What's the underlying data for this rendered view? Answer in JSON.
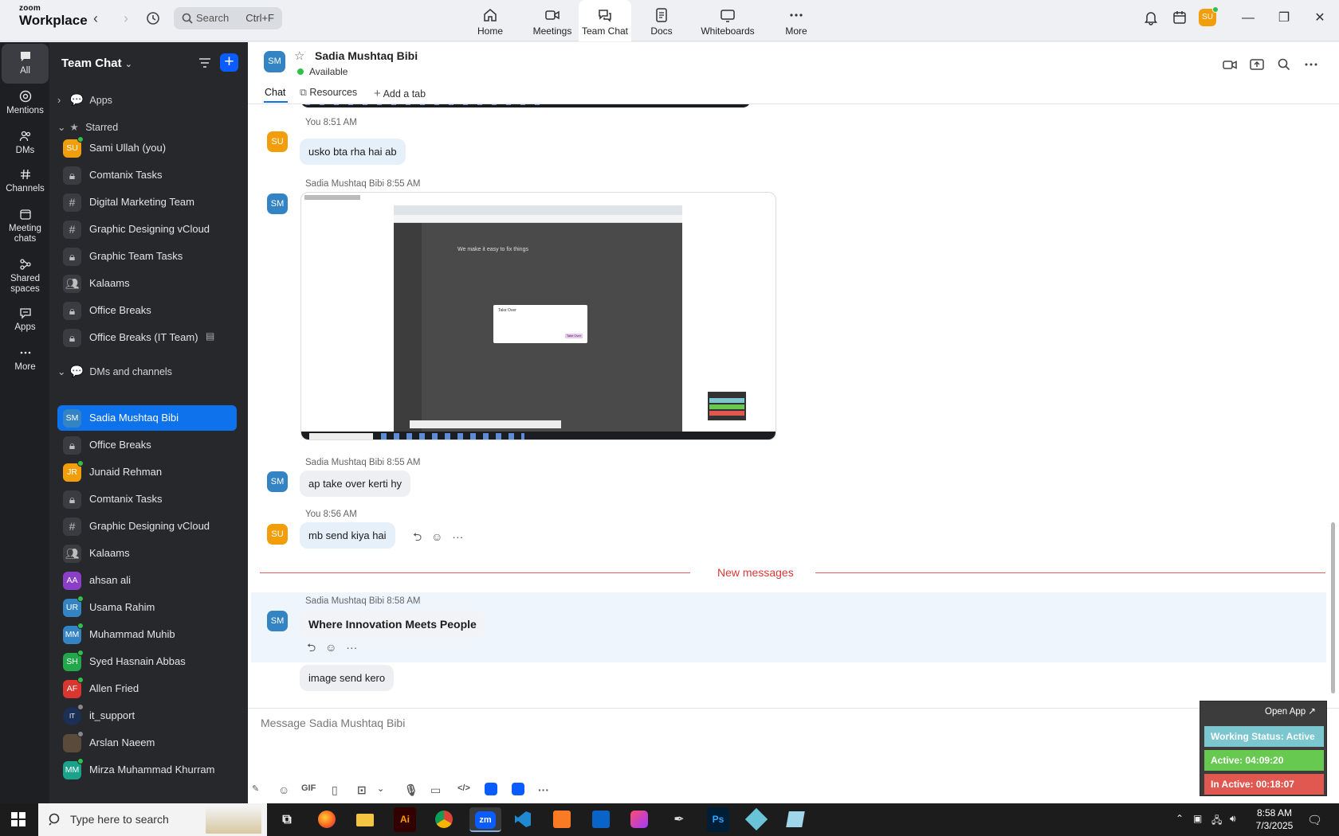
{
  "titlebar": {
    "logo_line1": "zoom",
    "logo_line2": "Workplace",
    "search_placeholder": "Search",
    "search_shortcut": "Ctrl+F",
    "tabs": [
      {
        "label": "Home",
        "icon": "home-icon"
      },
      {
        "label": "Meetings",
        "icon": "video-icon"
      },
      {
        "label": "Team Chat",
        "icon": "chat-icon"
      },
      {
        "label": "Docs",
        "icon": "doc-icon"
      },
      {
        "label": "Whiteboards",
        "icon": "whiteboard-icon"
      },
      {
        "label": "More",
        "icon": "more-icon"
      }
    ],
    "user_initials": "SU"
  },
  "rail": [
    {
      "label": "All"
    },
    {
      "label": "Mentions"
    },
    {
      "label": "DMs"
    },
    {
      "label": "Channels"
    },
    {
      "label": "Meeting chats"
    },
    {
      "label": "Shared spaces"
    },
    {
      "label": "Apps"
    },
    {
      "label": "More"
    }
  ],
  "sidebar": {
    "title": "Team Chat",
    "sections": {
      "apps": "Apps",
      "starred": "Starred",
      "dms": "DMs and channels"
    },
    "starred": [
      {
        "label": "Sami Ullah (you)",
        "initials": "SU",
        "color": "#f29e0b"
      },
      {
        "label": "Comtanix Tasks"
      },
      {
        "label": "Digital Marketing Team"
      },
      {
        "label": "Graphic Designing vCloud"
      },
      {
        "label": "Graphic Team Tasks"
      },
      {
        "label": "Kalaams"
      },
      {
        "label": "Office Breaks"
      },
      {
        "label": "Office Breaks (IT Team)"
      }
    ],
    "dms": [
      {
        "label": "Sadia Mushtaq Bibi",
        "initials": "SM",
        "color": "#3484c4"
      },
      {
        "label": "Office Breaks"
      },
      {
        "label": "Junaid Rehman",
        "initials": "JR",
        "color": "#f29e0b"
      },
      {
        "label": "Comtanix Tasks"
      },
      {
        "label": "Graphic Designing vCloud"
      },
      {
        "label": "Kalaams"
      },
      {
        "label": "ahsan ali",
        "initials": "AA",
        "color": "#8b3fc9"
      },
      {
        "label": "Usama Rahim",
        "initials": "UR",
        "color": "#3484c4"
      },
      {
        "label": "Muhammad Muhib",
        "initials": "MM",
        "color": "#3484c4"
      },
      {
        "label": "Syed Hasnain Abbas",
        "initials": "SH",
        "color": "#22a84a"
      },
      {
        "label": "Allen Fried",
        "initials": "AF",
        "color": "#d8362f"
      },
      {
        "label": "it_support",
        "initials": "IT"
      },
      {
        "label": "Arslan Naeem"
      },
      {
        "label": "Mirza Muhammad Khurram",
        "initials": "MM",
        "color": "#1aa38a"
      }
    ]
  },
  "chat": {
    "contact_initials": "SM",
    "contact_name": "Sadia Mushtaq Bibi",
    "status": "Available",
    "tabs": {
      "chat": "Chat",
      "resources": "Resources",
      "add": "Add a tab"
    },
    "messages": [
      {
        "sender": "You",
        "time": "8:51 AM",
        "text": "usko bta rha hai ab",
        "initials": "SU"
      },
      {
        "sender": "Sadia Mushtaq Bibi",
        "time": "8:55 AM",
        "initials": "SM",
        "screenshot_heading": "We make it easy to fix things",
        "dialog_title": "Take Over",
        "dialog_button": "Take Over"
      },
      {
        "sender": "Sadia Mushtaq Bibi",
        "time": "8:55 AM",
        "text": "ap take over kerti hy",
        "initials": "SM"
      },
      {
        "sender": "You",
        "time": "8:56 AM",
        "text": "mb send kiya hai",
        "initials": "SU"
      },
      {
        "sender": "Sadia Mushtaq Bibi",
        "time": "8:58 AM",
        "text": "Where Innovation Meets People",
        "initials": "SM"
      },
      {
        "text": "image send kero"
      }
    ],
    "new_messages_label": "New messages",
    "composer_placeholder": "Message Sadia Mushtaq Bibi",
    "gif_label": "GIF"
  },
  "widget": {
    "open_app": "Open App ↗",
    "working_status": "Working Status: Active",
    "active": "Active: 04:09:20",
    "inactive": "In Active: 00:18:07"
  },
  "taskbar": {
    "search_placeholder": "Type here to search",
    "time": "8:58 AM",
    "date": "7/3/2025",
    "apps": [
      {
        "label": "Ai",
        "color": "#330000",
        "fg": "#ff9a00"
      },
      {
        "label": "zm",
        "color": "#0b5cff",
        "fg": "#ffffff"
      },
      {
        "label": "Ps",
        "color": "#001e36",
        "fg": "#31a8ff"
      }
    ]
  }
}
